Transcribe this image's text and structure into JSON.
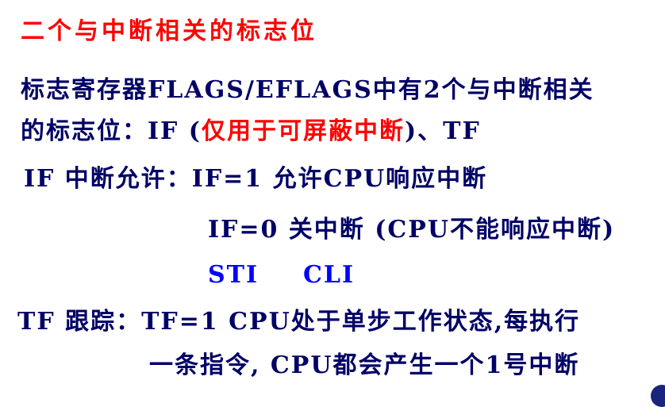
{
  "title": "二个与中断相关的标志位",
  "intro": {
    "line1": "标志寄存器FLAGS/EFLAGS中有2个与中断相关",
    "line2_a": "的标志位：IF (",
    "line2_red": "仅用于可屏蔽中断",
    "line2_b": ")、TF"
  },
  "if_section": {
    "label": "IF 中断允许：",
    "if1": "IF=1 允许CPU响应中断",
    "if0": "IF=0 关中断 (CPU不能响应中断)",
    "sti": "STI",
    "cli": "CLI"
  },
  "tf_section": {
    "line1": "TF 跟踪：TF=1 CPU处于单步工作状态,每执行",
    "line2": "一条指令, CPU都会产生一个1号中断"
  },
  "colors": {
    "title": "#ff0000",
    "body": "#000066",
    "highlight": "#ff0000",
    "instructions": "#0000ff"
  }
}
